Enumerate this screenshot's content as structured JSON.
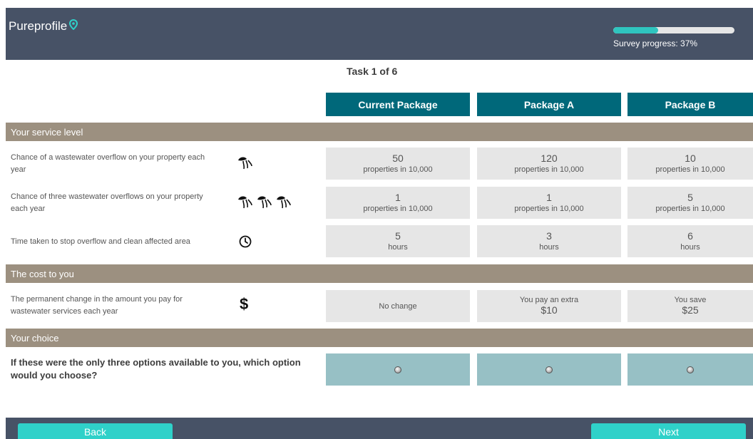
{
  "header": {
    "logo_text": "Pureprofile",
    "logo_icon": "location-pin-icon",
    "progress_percent": 37,
    "progress_label": "Survey progress: 37%",
    "accent_color": "#2fc5bf",
    "bar_color": "#475266"
  },
  "task": {
    "title": "Task 1 of 6"
  },
  "packages": [
    {
      "label": "Current Package"
    },
    {
      "label": "Package A"
    },
    {
      "label": "Package B"
    }
  ],
  "sections": {
    "service": "Your service level",
    "cost": "The cost to you",
    "choice": "Your choice"
  },
  "attributes": [
    {
      "label": "Chance of a wastewater overflow on your property each year",
      "icon": "single-overflow-icon",
      "cells": [
        {
          "big": "50",
          "small": "properties in 10,000"
        },
        {
          "big": "120",
          "small": "properties in 10,000"
        },
        {
          "big": "10",
          "small": "properties in 10,000"
        }
      ]
    },
    {
      "label": "Chance of three wastewater overflows on your property each year",
      "icon": "triple-overflow-icon",
      "cells": [
        {
          "big": "1",
          "small": "properties in 10,000"
        },
        {
          "big": "1",
          "small": "properties in 10,000"
        },
        {
          "big": "5",
          "small": "properties in 10,000"
        }
      ]
    },
    {
      "label": "Time taken to stop overflow and clean affected area",
      "icon": "clock-icon",
      "cells": [
        {
          "big": "5",
          "small": "hours"
        },
        {
          "big": "3",
          "small": "hours"
        },
        {
          "big": "6",
          "small": "hours"
        }
      ]
    }
  ],
  "cost": {
    "label": "The permanent change in the amount you pay for wastewater services each year",
    "icon": "dollar-icon",
    "symbol": "$",
    "cells": [
      {
        "top": "No change",
        "value": ""
      },
      {
        "top": "You pay an extra",
        "value": "$10"
      },
      {
        "top": "You save",
        "value": "$25"
      }
    ]
  },
  "question": "If these were the only three options available to you, which option would you choose?",
  "buttons": {
    "back": "Back",
    "next": "Next"
  }
}
